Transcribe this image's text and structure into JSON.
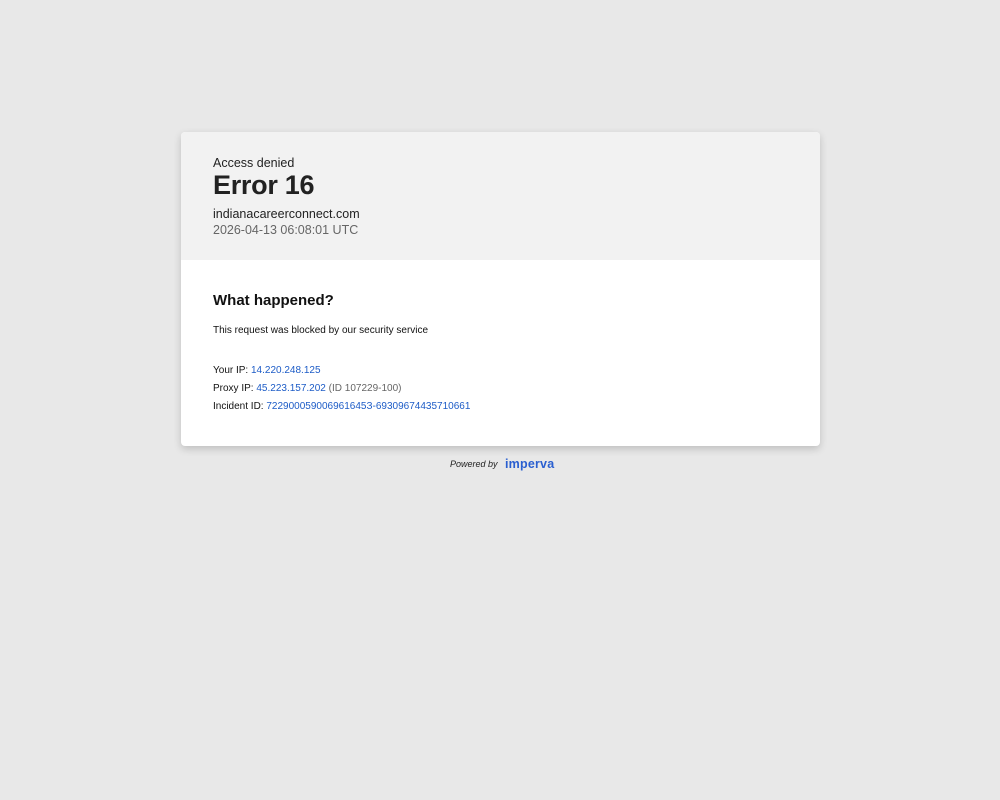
{
  "header": {
    "label": "Access denied",
    "title": "Error 16",
    "domain": "indianacareerconnect.com",
    "timestamp": "2026-04-13 06:08:01 UTC"
  },
  "body": {
    "heading": "What happened?",
    "message": "This request was blocked by our security service",
    "your_ip_label": "Your IP:",
    "your_ip": "14.220.248.125",
    "proxy_ip_label": "Proxy IP:",
    "proxy_ip": "45.223.157.202",
    "proxy_id": "(ID 107229-100)",
    "incident_label": "Incident ID:",
    "incident_id": "722900059006961645З-69309674435710661"
  },
  "footer": {
    "powered_by": "Powered by",
    "brand": "imperva"
  },
  "colors": {
    "background": "#e8e8e8",
    "link": "#1d5cc7",
    "brand": "#2a5fd0"
  }
}
